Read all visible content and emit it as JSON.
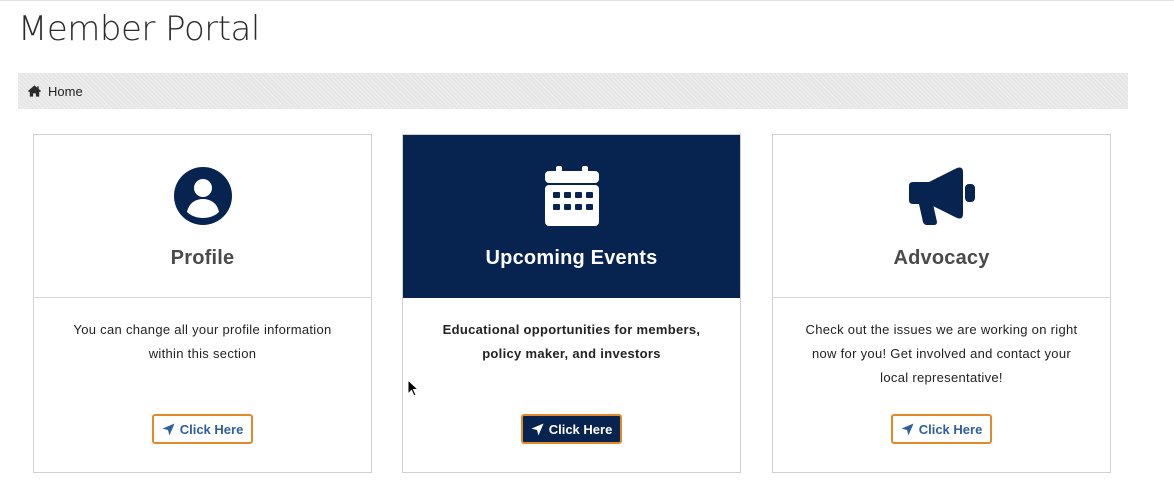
{
  "page": {
    "title": "Member Portal"
  },
  "breadcrumb": {
    "home_label": "Home",
    "icon": "home-icon"
  },
  "colors": {
    "navy": "#07234f",
    "orange_border": "#e4892a",
    "link_blue": "#2e5f9e"
  },
  "cards": [
    {
      "icon": "user-circle-icon",
      "title": "Profile",
      "description": "You can change all your profile information within this section",
      "button_label": "Click Here"
    },
    {
      "icon": "calendar-icon",
      "title": "Upcoming Events",
      "description": "Educational opportunities for members, policy maker, and investors",
      "button_label": "Click Here",
      "active": true
    },
    {
      "icon": "megaphone-icon",
      "title": "Advocacy",
      "description": "Check out the issues we are working on right now for you! Get involved and contact your local representative!",
      "button_label": "Click Here"
    }
  ]
}
